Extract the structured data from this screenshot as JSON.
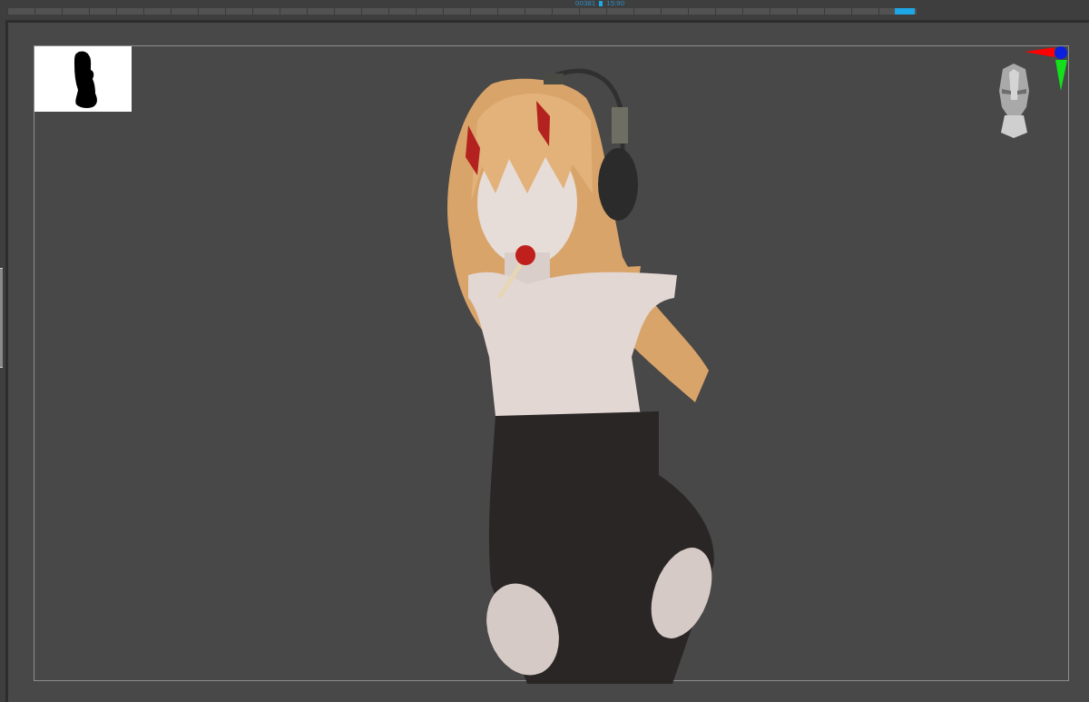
{
  "timeline": {
    "frame": "00381",
    "time": "15:90",
    "level": 0.998
  }
}
